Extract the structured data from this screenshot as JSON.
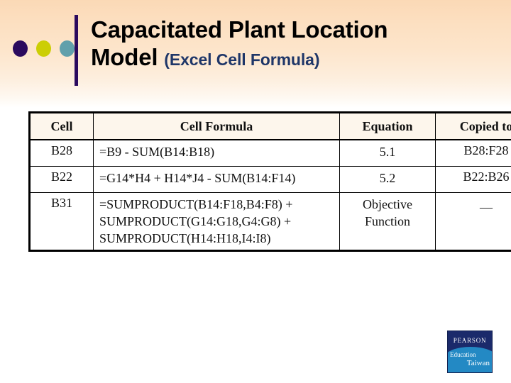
{
  "slide": {
    "title_line_1": "Capacitated Plant Location",
    "title_line_2": "Model",
    "subtitle": "(Excel Cell Formula)",
    "accent_colors": {
      "dot_purple": "#2b0a5e",
      "dot_yellow": "#ccce05",
      "dot_teal": "#61a0ab",
      "bar_purple": "#2b0a5e",
      "subtitle_blue": "#1f3668",
      "background_top": "#fbd9b6",
      "background_bottom": "#ffffff"
    },
    "decorative_dots": [
      "purple-dot",
      "yellow-dot",
      "teal-dot"
    ]
  },
  "table": {
    "headers": [
      "Cell",
      "Cell Formula",
      "Equation",
      "Copied to"
    ],
    "rows": [
      {
        "cell": "B28",
        "formula_lines": [
          "=B9 - SUM(B14:B18)"
        ],
        "equation_lines": [
          "5.1"
        ],
        "copied_to": "B28:F28"
      },
      {
        "cell": "B22",
        "formula_lines": [
          "=G14*H4 + H14*J4 - SUM(B14:F14)"
        ],
        "equation_lines": [
          "5.2"
        ],
        "copied_to": "B22:B26"
      },
      {
        "cell": "B31",
        "formula_lines": [
          "=SUMPRODUCT(B14:F18,B4:F8) +",
          "SUMPRODUCT(G14:G18,G4:G8) +",
          "SUMPRODUCT(H14:H18,I4:I8)"
        ],
        "equation_lines": [
          "Objective",
          "Function"
        ],
        "copied_to": "—"
      }
    ]
  },
  "logo": {
    "brand": "PEARSON",
    "line_2": "Education",
    "line_3": "Taiwan"
  }
}
